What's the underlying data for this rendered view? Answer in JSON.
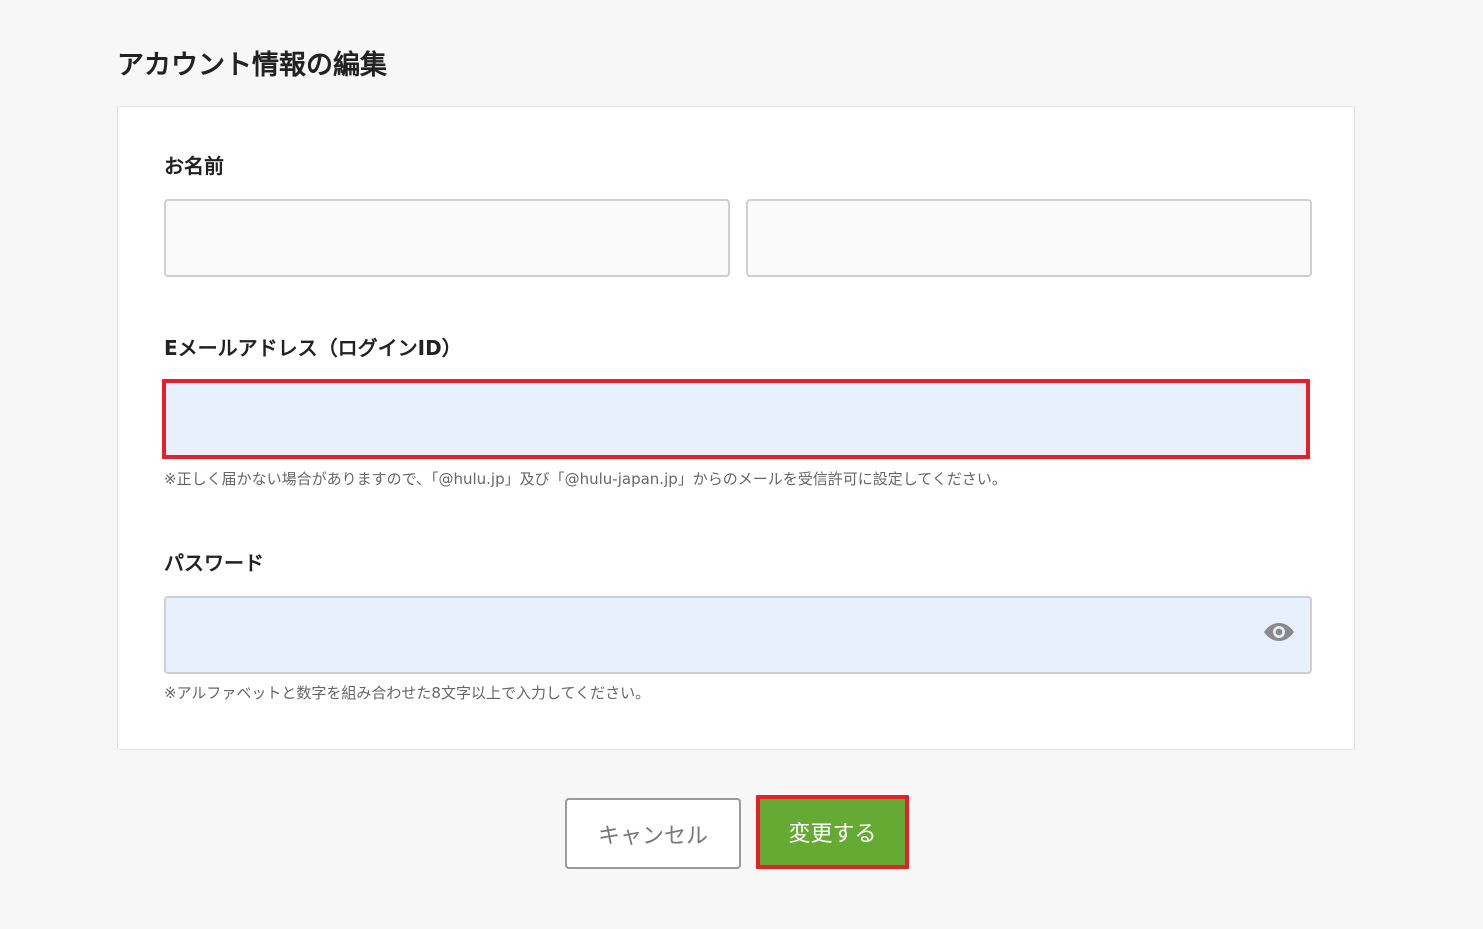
{
  "page": {
    "title": "アカウント情報の編集"
  },
  "form": {
    "name": {
      "label": "お名前",
      "last_name_value": "",
      "first_name_value": ""
    },
    "email": {
      "label": "Eメールアドレス（ログインID）",
      "value": "",
      "hint": "※正しく届かない場合がありますので、「@hulu.jp」及び「@hulu-japan.jp」からのメールを受信許可に設定してください。"
    },
    "password": {
      "label": "パスワード",
      "value": "",
      "toggle_icon": "eye-icon",
      "hint": "※アルファベットと数字を組み合わせた8文字以上で入力してください。"
    }
  },
  "actions": {
    "cancel_label": "キャンセル",
    "submit_label": "変更する"
  },
  "colors": {
    "background": "#f7f7f7",
    "card": "#ffffff",
    "autofill": "#e8f0fe",
    "highlight": "#e5202a",
    "submit": "#65ab33"
  }
}
